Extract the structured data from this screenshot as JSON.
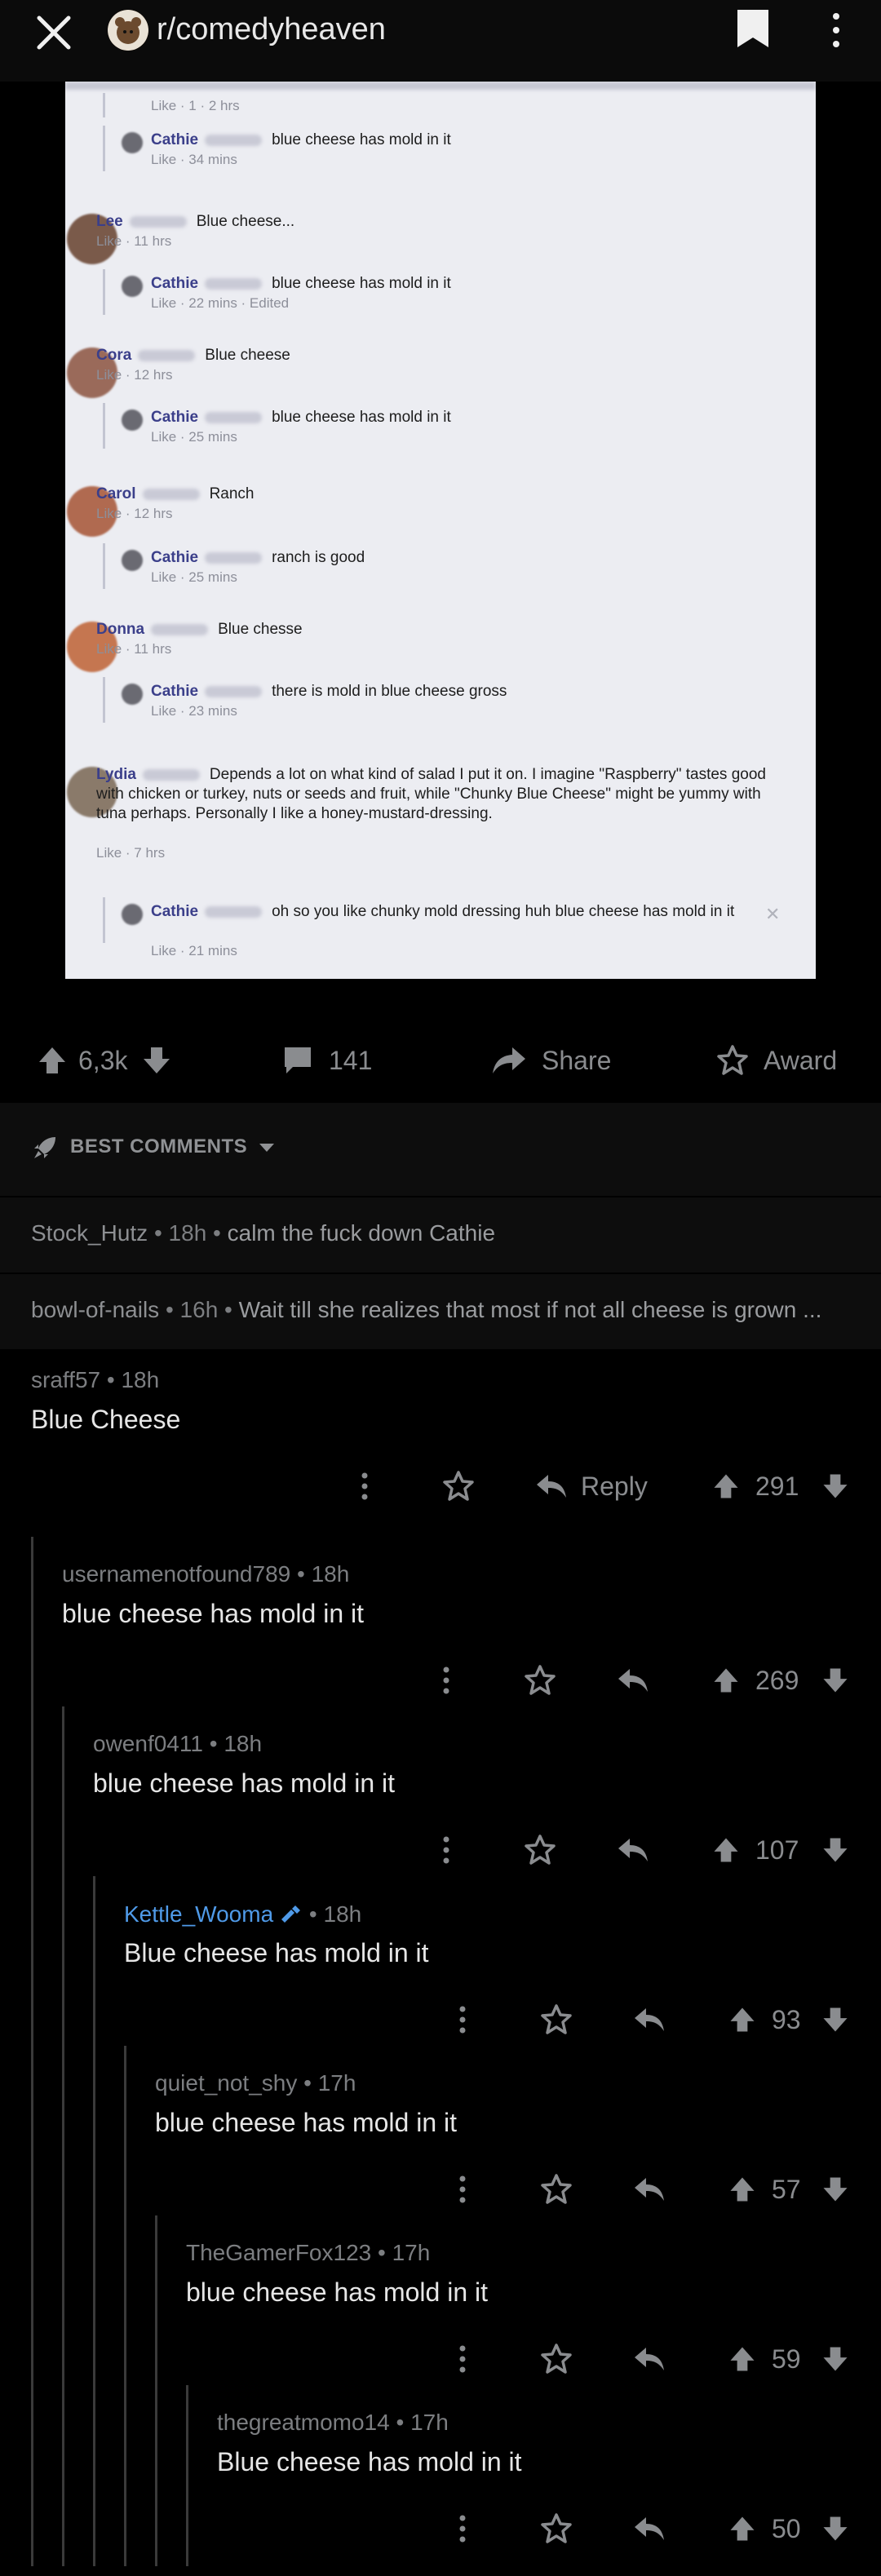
{
  "header": {
    "subreddit": "r/comedyheaven",
    "icons": [
      "close-icon",
      "subreddit-avatar",
      "bookmark-icon",
      "more-vertical-icon"
    ]
  },
  "post_image": {
    "entries": [
      {
        "kind": "reply",
        "name": "",
        "meta": "Like · 1 · 2 hrs",
        "text": "",
        "top": true
      },
      {
        "kind": "reply",
        "name": "Cathie",
        "text": "blue cheese has mold in it",
        "meta": "Like · 34 mins"
      },
      {
        "kind": "comment",
        "name": "Lee",
        "text": "Blue cheese...",
        "meta": "Like · 11 hrs"
      },
      {
        "kind": "reply",
        "name": "Cathie",
        "text": "blue cheese has mold in it",
        "meta": "Like · 22 mins · Edited"
      },
      {
        "kind": "comment",
        "name": "Cora",
        "text": "Blue cheese",
        "meta": "Like · 12 hrs"
      },
      {
        "kind": "reply",
        "name": "Cathie",
        "text": "blue cheese has mold in it",
        "meta": "Like · 25 mins"
      },
      {
        "kind": "comment",
        "name": "Carol",
        "text": "Ranch",
        "meta": "Like · 12 hrs"
      },
      {
        "kind": "reply",
        "name": "Cathie",
        "text": "ranch is good",
        "meta": "Like · 25 mins"
      },
      {
        "kind": "comment",
        "name": "Donna",
        "text": "Blue chesse",
        "meta": "Like · 11 hrs"
      },
      {
        "kind": "reply",
        "name": "Cathie",
        "text": "there is mold in blue cheese gross",
        "meta": "Like · 23 mins"
      },
      {
        "kind": "comment",
        "name": "Lydia",
        "text": "Depends a lot on what kind of salad I put it on. I imagine \"Raspberry\" tastes good with chicken or turkey, nuts or seeds and fruit, while \"Chunky Blue Cheese\" might be yummy with tuna perhaps. Personally I like a honey-mustard-dressing.",
        "meta": "Like · 7 hrs"
      },
      {
        "kind": "reply",
        "name": "Cathie",
        "text": "oh so you like chunky mold dressing huh blue cheese has mold in it",
        "meta": "Like · 21 mins"
      }
    ]
  },
  "actions": {
    "score": "6,3k",
    "comments": "141",
    "share": "Share",
    "award": "Award"
  },
  "sort": {
    "label": "BEST COMMENTS"
  },
  "collapsed": [
    {
      "user": "Stock_Hutz",
      "age": "18h",
      "text": "calm the fuck down Cathie"
    },
    {
      "user": "bowl-of-nails",
      "age": "16h",
      "text": "Wait till she realizes that most if not all cheese is grown ..."
    }
  ],
  "thread": [
    {
      "user": "sraff57",
      "age": "18h",
      "text": "Blue Cheese",
      "score": "291",
      "reply_label": "Reply",
      "mod": false
    },
    {
      "user": "usernamenotfound789",
      "age": "18h",
      "text": "blue cheese has mold in it",
      "score": "269",
      "mod": false
    },
    {
      "user": "owenf0411",
      "age": "18h",
      "text": "blue cheese has mold in it",
      "score": "107",
      "mod": false
    },
    {
      "user": "Kettle_Wooma",
      "age": "18h",
      "text": "Blue cheese has mold in it",
      "score": "93",
      "mod": true
    },
    {
      "user": "quiet_not_shy",
      "age": "17h",
      "text": "blue cheese has mold in it",
      "score": "57",
      "mod": false
    },
    {
      "user": "TheGamerFox123",
      "age": "17h",
      "text": "blue cheese has mold in it",
      "score": "59",
      "mod": false
    },
    {
      "user": "thegreatmomo14",
      "age": "17h",
      "text": "Blue cheese has mold in it",
      "score": "50",
      "mod": false
    }
  ],
  "colors": {
    "accent_blue": "#4f9ae8",
    "background": "#000000",
    "muted": "#8a8c8f"
  }
}
